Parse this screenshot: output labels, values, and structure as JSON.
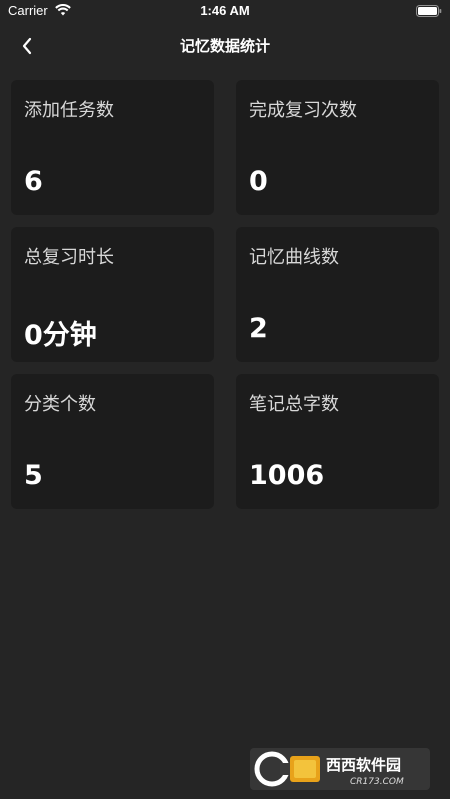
{
  "status_bar": {
    "carrier": "Carrier",
    "time": "1:46 AM"
  },
  "nav": {
    "title": "记忆数据统计",
    "back_icon": "chevron-left-icon"
  },
  "stats": [
    {
      "label": "添加任务数",
      "value": "6"
    },
    {
      "label": "完成复习次数",
      "value": "0"
    },
    {
      "label": "总复习时长",
      "value": "0分钟"
    },
    {
      "label": "记忆曲线数",
      "value": "2"
    },
    {
      "label": "分类个数",
      "value": "5"
    },
    {
      "label": "笔记总字数",
      "value": "1006"
    }
  ],
  "watermark": {
    "brand": "西西软件园",
    "url": "CR173.COM"
  },
  "colors": {
    "background": "#252525",
    "card": "#1c1c1c",
    "text": "#ffffff"
  }
}
